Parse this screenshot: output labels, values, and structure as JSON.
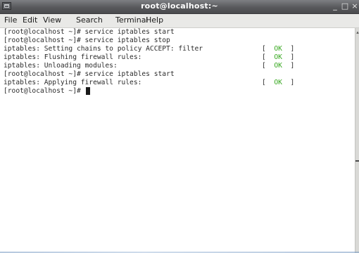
{
  "window": {
    "title": "root@localhost:~",
    "menu_icon": "window-menu-icon",
    "controls": {
      "minimize": "_",
      "maximize": "□",
      "close": "×"
    }
  },
  "menubar": [
    "File",
    "Edit",
    "View",
    "Search",
    "Terminal",
    "Help"
  ],
  "terminal": {
    "lines": [
      {
        "text": "[root@localhost ~]# service iptables start",
        "status": null
      },
      {
        "text": "[root@localhost ~]# service iptables stop",
        "status": null
      },
      {
        "text": "iptables: Setting chains to policy ACCEPT: filter",
        "status": "OK"
      },
      {
        "text": "iptables: Flushing firewall rules:",
        "status": "OK"
      },
      {
        "text": "iptables: Unloading modules:",
        "status": "OK"
      },
      {
        "text": "[root@localhost ~]# service iptables start",
        "status": null
      },
      {
        "text": "iptables: Applying firewall rules:",
        "status": "OK"
      },
      {
        "text": "[root@localhost ~]# ",
        "status": null,
        "cursor": true
      }
    ],
    "status_bracket_open": "[",
    "status_bracket_close": "]",
    "ok_color": "#38a820",
    "text_color": "#2b2b2b",
    "background": "#ffffff"
  },
  "scrollbar": {
    "up_arrow": "▴"
  }
}
